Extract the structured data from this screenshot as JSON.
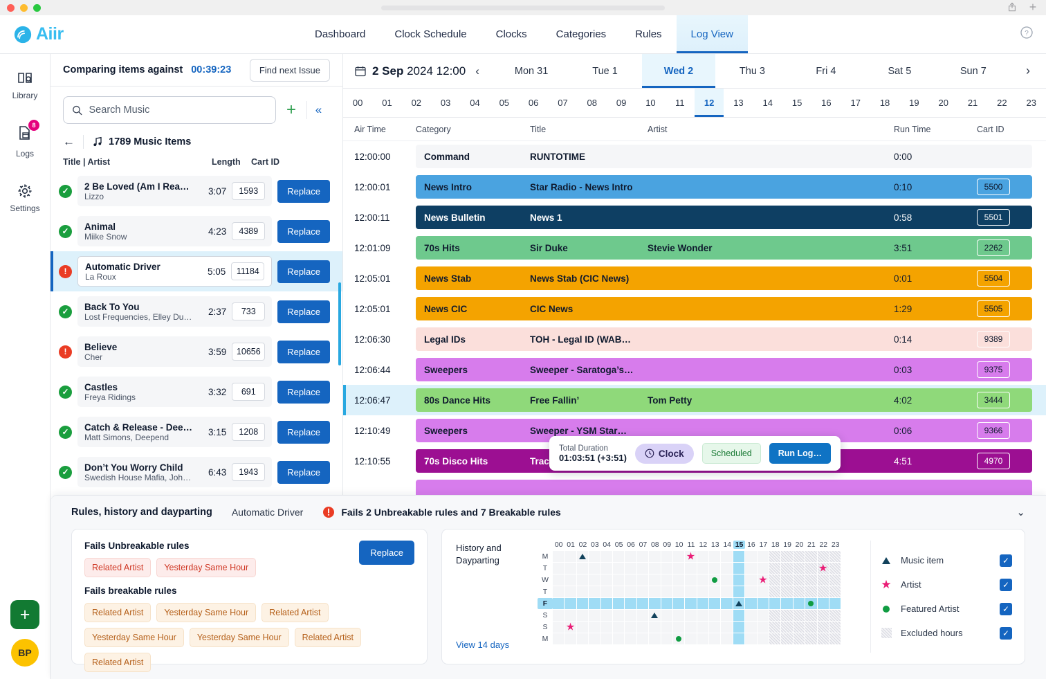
{
  "window": {
    "share_icon": "share-icon",
    "plus_icon": "plus-icon"
  },
  "brand": {
    "name": "Aiir"
  },
  "topnav": {
    "items": [
      {
        "label": "Dashboard",
        "active": false
      },
      {
        "label": "Clock Schedule",
        "active": false
      },
      {
        "label": "Clocks",
        "active": false
      },
      {
        "label": "Categories",
        "active": false
      },
      {
        "label": "Rules",
        "active": false
      },
      {
        "label": "Log View",
        "active": true
      }
    ],
    "help_icon": "help-circle-icon"
  },
  "rail": {
    "items": [
      {
        "label": "Library",
        "icon": "library-icon",
        "badge": ""
      },
      {
        "label": "Logs",
        "icon": "logs-icon",
        "badge": "8"
      },
      {
        "label": "Settings",
        "icon": "gear-icon",
        "badge": ""
      }
    ],
    "add_label": "+",
    "avatar_initials": "BP"
  },
  "music_panel": {
    "compare_label": "Comparing items against",
    "compare_time": "00:39:23",
    "find_next_label": "Find next Issue",
    "search_placeholder": "Search Music",
    "search_value": "",
    "count_label": "1789 Music Items",
    "columns": {
      "title": "Title | Artist",
      "length": "Length",
      "cart": "Cart ID"
    },
    "replace_label": "Replace",
    "items": [
      {
        "status": "ok",
        "title": "2 Be Loved (Am I Ready)",
        "artist": "Lizzo",
        "length": "3:07",
        "cart": "1593",
        "selected": false
      },
      {
        "status": "ok",
        "title": "Animal",
        "artist": "Miike Snow",
        "length": "4:23",
        "cart": "4389",
        "selected": false
      },
      {
        "status": "err",
        "title": "Automatic Driver",
        "artist": "La Roux",
        "length": "5:05",
        "cart": "11184",
        "selected": true
      },
      {
        "status": "ok",
        "title": "Back To You",
        "artist": "Lost Frequencies, Elley Du…",
        "length": "2:37",
        "cart": "733",
        "selected": false
      },
      {
        "status": "err",
        "title": "Believe",
        "artist": "Cher",
        "length": "3:59",
        "cart": "10656",
        "selected": false
      },
      {
        "status": "ok",
        "title": "Castles",
        "artist": "Freya Ridings",
        "length": "3:32",
        "cart": "691",
        "selected": false
      },
      {
        "status": "ok",
        "title": "Catch & Release - Dee…",
        "artist": "Matt Simons, Deepend",
        "length": "3:15",
        "cart": "1208",
        "selected": false
      },
      {
        "status": "ok",
        "title": "Don’t You Worry Child",
        "artist": "Swedish House Mafia, Joh…",
        "length": "6:43",
        "cart": "1943",
        "selected": false
      }
    ]
  },
  "logview": {
    "date_day": "2 Sep",
    "date_year": "2024",
    "date_time": "12:00",
    "prev_icon": "chevron-left-icon",
    "next_icon": "chevron-right-icon",
    "days": [
      {
        "label": "Mon 31",
        "active": false
      },
      {
        "label": "Tue 1",
        "active": false
      },
      {
        "label": "Wed 2",
        "active": true
      },
      {
        "label": "Thu 3",
        "active": false
      },
      {
        "label": "Fri 4",
        "active": false
      },
      {
        "label": "Sat 5",
        "active": false
      },
      {
        "label": "Sun 7",
        "active": false
      }
    ],
    "hours": [
      "00",
      "01",
      "02",
      "03",
      "04",
      "05",
      "06",
      "07",
      "08",
      "09",
      "10",
      "11",
      "12",
      "13",
      "14",
      "15",
      "16",
      "17",
      "18",
      "19",
      "20",
      "21",
      "22",
      "23"
    ],
    "active_hour": "12",
    "columns": {
      "air": "Air Time",
      "category": "Category",
      "title": "Title",
      "artist": "Artist",
      "run": "Run Time",
      "cart": "Cart ID"
    },
    "rows": [
      {
        "air": "12:00:00",
        "category": "Command",
        "title": "RUNTOTIME",
        "artist": "",
        "run": "0:00",
        "cart": "",
        "bg": "#f5f6f8",
        "fg": "#0f1a2e",
        "chip_border": "",
        "current": false
      },
      {
        "air": "12:00:01",
        "category": "News Intro",
        "title": "Star Radio - News Intro",
        "artist": "",
        "run": "0:10",
        "cart": "5500",
        "bg": "#4aa3e0",
        "fg": "#0f1a2e",
        "chip_border": "#ffffff",
        "current": false
      },
      {
        "air": "12:00:11",
        "category": "News Bulletin",
        "title": "News 1",
        "artist": "",
        "run": "0:58",
        "cart": "5501",
        "bg": "#0e3f63",
        "fg": "#ffffff",
        "chip_border": "#ffffff",
        "current": false
      },
      {
        "air": "12:01:09",
        "category": "70s Hits",
        "title": "Sir Duke",
        "artist": "Stevie Wonder",
        "run": "3:51",
        "cart": "2262",
        "bg": "#6ec98d",
        "fg": "#0f1a2e",
        "chip_border": "#ffffff",
        "current": false
      },
      {
        "air": "12:05:01",
        "category": "News Stab",
        "title": "News Stab (CIC News)",
        "artist": "",
        "run": "0:01",
        "cart": "5504",
        "bg": "#f4a300",
        "fg": "#0f1a2e",
        "chip_border": "#ffffff",
        "current": false
      },
      {
        "air": "12:05:01",
        "category": "News CIC",
        "title": "CIC News",
        "artist": "",
        "run": "1:29",
        "cart": "5505",
        "bg": "#f4a300",
        "fg": "#0f1a2e",
        "chip_border": "#ffffff",
        "current": false
      },
      {
        "air": "12:06:30",
        "category": "Legal IDs",
        "title": "TOH - Legal ID (WAB…",
        "artist": "",
        "run": "0:14",
        "cart": "9389",
        "bg": "#fbdfdb",
        "fg": "#0f1a2e",
        "chip_border": "#ffffff",
        "current": false
      },
      {
        "air": "12:06:44",
        "category": "Sweepers",
        "title": "Sweeper - Saratoga’s…",
        "artist": "",
        "run": "0:03",
        "cart": "9375",
        "bg": "#d77cec",
        "fg": "#0f1a2e",
        "chip_border": "#ffffff",
        "current": false
      },
      {
        "air": "12:06:47",
        "category": "80s Dance Hits",
        "title": "Free Fallin’",
        "artist": "Tom Petty",
        "run": "4:02",
        "cart": "3444",
        "bg": "#8fd97a",
        "fg": "#0f1a2e",
        "chip_border": "#ffffff",
        "current": true
      },
      {
        "air": "12:10:49",
        "category": "Sweepers",
        "title": "Sweeper - YSM Star…",
        "artist": "",
        "run": "0:06",
        "cart": "9366",
        "bg": "#d77cec",
        "fg": "#0f1a2e",
        "chip_border": "#ffffff",
        "current": false
      },
      {
        "air": "12:10:55",
        "category": "70s Disco Hits",
        "title": "Trac",
        "artist": "",
        "run": "4:51",
        "cart": "4970",
        "bg": "#9c0f92",
        "fg": "#ffffff",
        "chip_border": "#ffffff",
        "current": false
      },
      {
        "air": "",
        "category": "",
        "title": "",
        "artist": "",
        "run": "",
        "cart": "",
        "bg": "#d77cec",
        "fg": "#0f1a2e",
        "chip_border": "#ffffff",
        "current": false
      }
    ],
    "tooltip": {
      "duration_label": "Total Duration",
      "duration_value": "01:03:51 (+3:51)",
      "clock_label": "Clock",
      "clock_icon": "clock-icon",
      "scheduled_label": "Scheduled",
      "run_log_label": "Run Log…"
    }
  },
  "bottom": {
    "title": "Rules, history and dayparting",
    "subject": "Automatic Driver",
    "fail_text": "Fails 2 Unbreakable rules and 7 Breakable rules",
    "fail_icon": "alert-icon",
    "collapse_icon": "chevron-down-icon",
    "replace_label": "Replace",
    "unbreakable_heading": "Fails Unbreakable rules",
    "unbreakable_tags": [
      "Related Artist",
      "Yesterday Same Hour"
    ],
    "breakable_heading": "Fails breakable rules",
    "breakable_tags": [
      "Related Artist",
      "Yesterday Same Hour",
      "Related Artist",
      "Yesterday Same Hour",
      "Yesterday Same Hour",
      "Related Artist",
      "Related Artist"
    ],
    "history": {
      "title": "History and Dayparting",
      "view_link": "View 14 days",
      "hours": [
        "00",
        "01",
        "02",
        "03",
        "04",
        "05",
        "06",
        "07",
        "08",
        "09",
        "10",
        "11",
        "12",
        "13",
        "14",
        "15",
        "16",
        "17",
        "18",
        "19",
        "20",
        "21",
        "22",
        "23"
      ],
      "selected_hour_index": 15,
      "day_labels": [
        "M",
        "T",
        "W",
        "T",
        "F",
        "S",
        "S",
        "M"
      ],
      "selected_day_index": 4,
      "excluded_start_hour": 18,
      "markers": [
        {
          "row": 0,
          "hour": 2,
          "type": "triangle"
        },
        {
          "row": 0,
          "hour": 11,
          "type": "star"
        },
        {
          "row": 1,
          "hour": 22,
          "type": "star"
        },
        {
          "row": 2,
          "hour": 13,
          "type": "dot"
        },
        {
          "row": 2,
          "hour": 17,
          "type": "star"
        },
        {
          "row": 4,
          "hour": 15,
          "type": "triangle"
        },
        {
          "row": 4,
          "hour": 21,
          "type": "dot"
        },
        {
          "row": 5,
          "hour": 8,
          "type": "triangle"
        },
        {
          "row": 6,
          "hour": 1,
          "type": "star"
        },
        {
          "row": 7,
          "hour": 10,
          "type": "dot"
        }
      ]
    },
    "legend": [
      {
        "icon": "triangle-icon",
        "label": "Music item",
        "checked": true
      },
      {
        "icon": "star-icon",
        "label": "Artist",
        "checked": true
      },
      {
        "icon": "circle-icon",
        "label": "Featured Artist",
        "checked": true
      },
      {
        "icon": "hatch-swatch-icon",
        "label": "Excluded hours",
        "checked": true
      }
    ]
  }
}
